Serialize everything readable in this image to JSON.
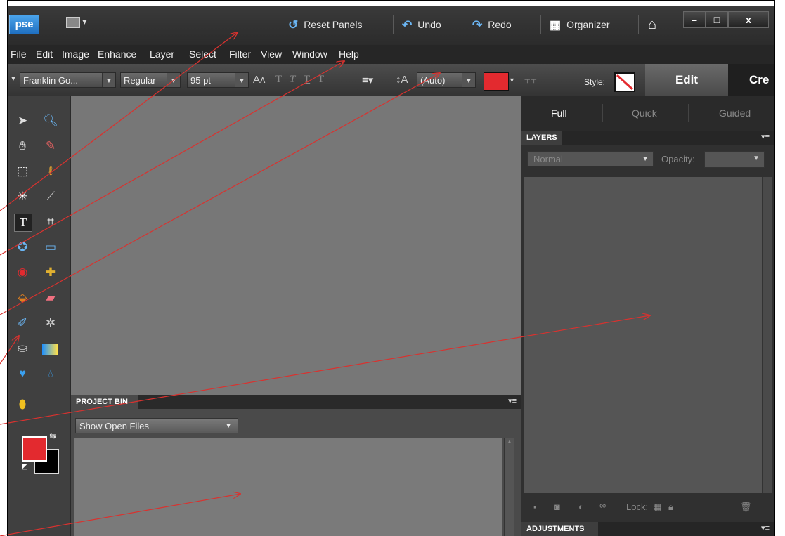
{
  "app": {
    "logo": "pse",
    "colors": {
      "accent": "#6bb6f4",
      "foreground_swatch": "#e32a2f",
      "annotation": "#d9322f"
    }
  },
  "topbar": {
    "reset_panels": "Reset Panels",
    "undo": "Undo",
    "redo": "Redo",
    "organizer": "Organizer",
    "icons": [
      "reset-icon",
      "undo-icon",
      "redo-icon",
      "organizer-icon",
      "home-icon"
    ],
    "window_controls": [
      "–",
      "□",
      "x"
    ]
  },
  "menubar": {
    "items": [
      "File",
      "Edit",
      "Image",
      "Enhance",
      "Layer",
      "Select",
      "Filter",
      "View",
      "Window",
      "Help"
    ]
  },
  "options": {
    "font_family": "Franklin Go...",
    "font_style": "Regular",
    "font_size": "95 pt",
    "leading": "(Auto)",
    "style_label": "Style:",
    "text_color": "#e32a2f"
  },
  "mode_tabs": {
    "edit": "Edit",
    "create": "Cre"
  },
  "edit_modes": [
    "Full",
    "Quick",
    "Guided"
  ],
  "layers": {
    "title": "LAYERS",
    "blend_mode": "Normal",
    "opacity_label": "Opacity:",
    "lock_label": "Lock:"
  },
  "adjustments": {
    "title": "ADJUSTMENTS"
  },
  "project_bin": {
    "title": "PROJECT BIN",
    "filter": "Show Open Files"
  }
}
